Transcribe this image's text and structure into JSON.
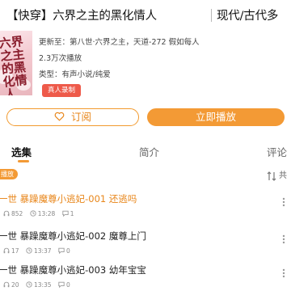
{
  "book": {
    "title": "【快穿】六界之主的黑化情人",
    "genre": "现代/古代多",
    "cover_text": "六界之主的黑化情人",
    "update_info": "更新至：第八世·六界之主，天道-272 假如每人",
    "play_count": "2.3万次播放",
    "category": "类型：有声小说/纯爱",
    "tag": "真人录制"
  },
  "actions": {
    "subscribe_label": "订阅",
    "play_label": "立即播放"
  },
  "tabs": {
    "episodes": "选集",
    "intro": "简介",
    "comments": "评论"
  },
  "toolbar": {
    "playing_badge": "播放",
    "total_text": "共"
  },
  "episodes": [
    {
      "title": "一世 暴躁魔尊小逃妃-001 还逃吗",
      "plays": "852",
      "duration": "13:28",
      "comments": "1",
      "active": true
    },
    {
      "title": "一世 暴躁魔尊小逃妃-002 魔尊上门",
      "plays": "17",
      "duration": "13:37",
      "comments": "0",
      "active": false
    },
    {
      "title": "一世 暴躁魔尊小逃妃-003 幼年宝宝",
      "plays": "20",
      "duration": "13:35",
      "comments": "0",
      "active": false
    }
  ],
  "colors": {
    "accent": "#f39a35",
    "accent_text": "#e8861a",
    "tag_bg": "#ee5a4a"
  },
  "icons": {
    "subscribe": "heart-outline-icon",
    "sort": "sort-icon",
    "more": "more-options-icon",
    "plays": "headphones-icon",
    "duration": "clock-icon",
    "comments": "comment-icon"
  }
}
